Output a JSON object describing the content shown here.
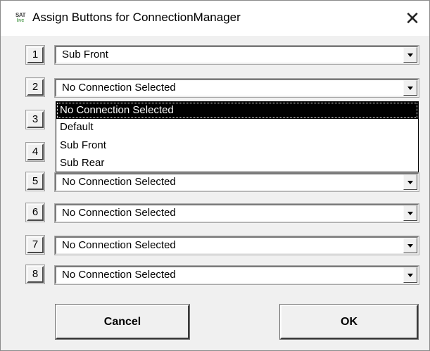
{
  "window": {
    "app_icon": {
      "line1": "SAT",
      "line2": "live"
    },
    "title": "Assign Buttons for ConnectionManager",
    "close_glyph": "✕"
  },
  "rows": [
    {
      "number": "1",
      "value": "Sub Front"
    },
    {
      "number": "2",
      "value": "No Connection Selected"
    },
    {
      "number": "3",
      "value": ""
    },
    {
      "number": "4",
      "value": ""
    },
    {
      "number": "5",
      "value": "No Connection Selected"
    },
    {
      "number": "6",
      "value": "No Connection Selected"
    },
    {
      "number": "7",
      "value": "No Connection Selected"
    },
    {
      "number": "8",
      "value": "No Connection Selected"
    }
  ],
  "dropdown": {
    "options": [
      "No Connection Selected",
      "Default",
      "Sub Front",
      "Sub Rear"
    ],
    "selected_index": 0
  },
  "buttons": {
    "cancel": "Cancel",
    "ok": "OK"
  },
  "colors": {
    "selection_bg": "#000000",
    "selection_fg": "#ffffff",
    "dialog_bg": "#f0f0f0"
  }
}
